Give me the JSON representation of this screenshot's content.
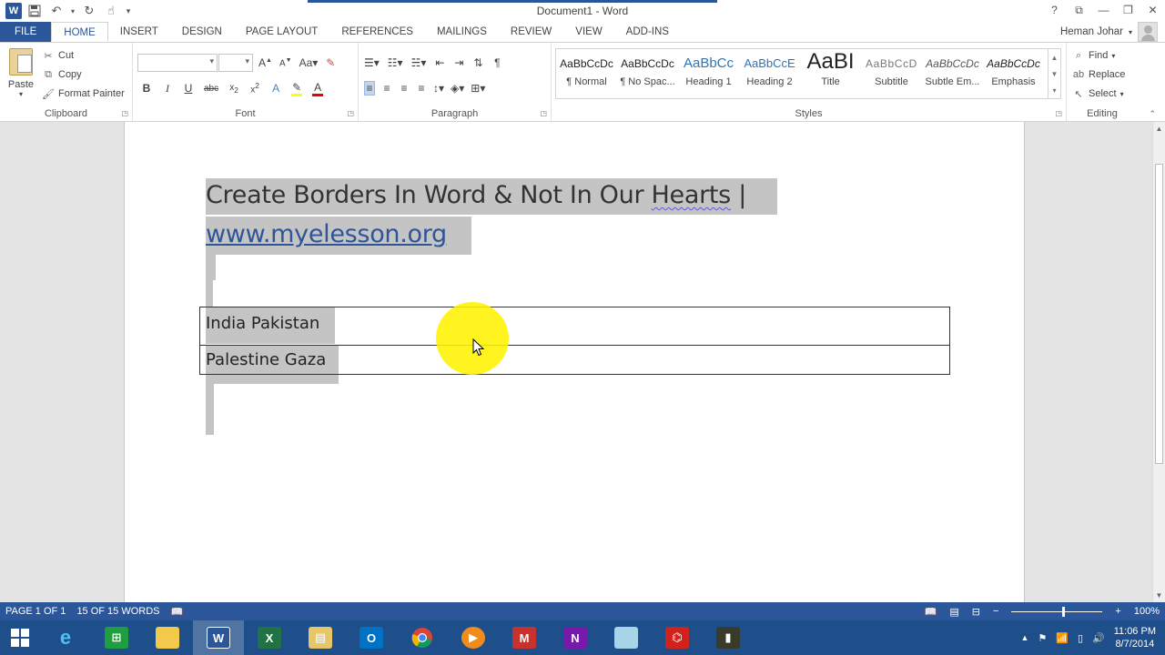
{
  "window": {
    "title": "Document1 - Word"
  },
  "tabs": [
    "FILE",
    "HOME",
    "INSERT",
    "DESIGN",
    "PAGE LAYOUT",
    "REFERENCES",
    "MAILINGS",
    "REVIEW",
    "VIEW",
    "ADD-INS"
  ],
  "user": {
    "name": "Heman Johar"
  },
  "clipboard": {
    "paste": "Paste",
    "cut": "Cut",
    "copy": "Copy",
    "format_painter": "Format Painter",
    "label": "Clipboard"
  },
  "font": {
    "label": "Font",
    "name": "",
    "size": ""
  },
  "paragraph": {
    "label": "Paragraph"
  },
  "styles": {
    "label": "Styles",
    "items": [
      {
        "sample": "AaBbCcDc",
        "name": "¶ Normal"
      },
      {
        "sample": "AaBbCcDc",
        "name": "¶ No Spac..."
      },
      {
        "sample": "AaBbCc",
        "name": "Heading 1"
      },
      {
        "sample": "AaBbCcE",
        "name": "Heading 2"
      },
      {
        "sample": "AaBI",
        "name": "Title"
      },
      {
        "sample": "AaBbCcD",
        "name": "Subtitle"
      },
      {
        "sample": "AaBbCcDc",
        "name": "Subtle Em..."
      },
      {
        "sample": "AaBbCcDc",
        "name": "Emphasis"
      }
    ]
  },
  "editing": {
    "label": "Editing",
    "find": "Find",
    "replace": "Replace",
    "select": "Select"
  },
  "document": {
    "title_start": "Create Borders In Word & Not In Our ",
    "title_wavy": "Hearts",
    "title_end": "  |",
    "link": "www.myelesson.org",
    "table_rows": [
      "India Pakistan",
      "Palestine Gaza"
    ]
  },
  "status": {
    "page": "PAGE 1 OF 1",
    "words": "15 OF 15 WORDS",
    "zoom": "100%",
    "zoom_level_percent": 100
  },
  "taskbar": {
    "time": "11:06 PM",
    "date": "8/7/2014"
  },
  "colors": {
    "accent": "#2b579a",
    "highlight": "#c4c4c4",
    "cursor_halo": "#fff200",
    "link": "#2e5597"
  }
}
